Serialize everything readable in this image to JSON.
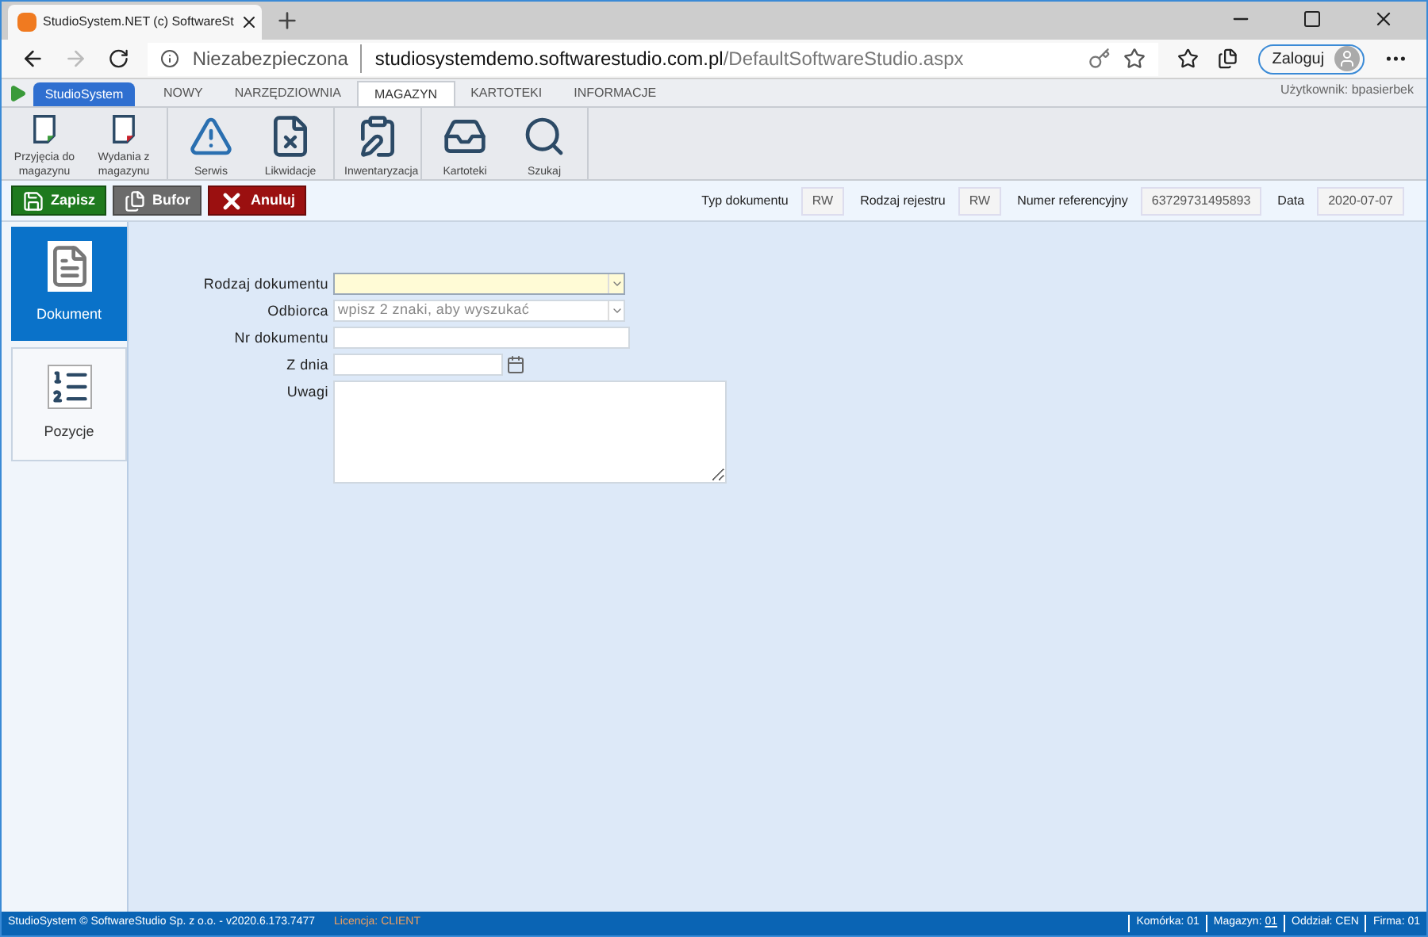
{
  "browser": {
    "tab_title": "StudioSystem.NET (c) SoftwareSt",
    "security": "Niezabezpieczona",
    "url_host": "studiosystemdemo.softwarestudio.com.pl",
    "url_path": "/DefaultSoftwareStudio.aspx",
    "profile_button": "Zaloguj"
  },
  "menu": {
    "app_button": "StudioSystem",
    "tabs": [
      {
        "label": "NOWY",
        "selected": false
      },
      {
        "label": "NARZĘDZIOWNIA",
        "selected": false
      },
      {
        "label": "MAGAZYN",
        "selected": true
      },
      {
        "label": "KARTOTEKI",
        "selected": false
      },
      {
        "label": "INFORMACJE",
        "selected": false
      }
    ],
    "user": "Użytkownik: bpasierbek"
  },
  "ribbon": [
    {
      "items": [
        {
          "kind": "doc-in",
          "label": "Przyjęcia do magazynu"
        },
        {
          "kind": "doc-out",
          "label": "Wydania z magazynu"
        }
      ]
    },
    {
      "items": [
        {
          "kind": "warning",
          "label": "Serwis"
        },
        {
          "kind": "doc-x",
          "label": "Likwidacje"
        }
      ]
    },
    {
      "items": [
        {
          "kind": "clipboard",
          "label": "Inwentaryzacja"
        }
      ]
    },
    {
      "items": [
        {
          "kind": "inbox",
          "label": "Kartoteki"
        },
        {
          "kind": "search",
          "label": "Szukaj"
        }
      ]
    }
  ],
  "actions": [
    {
      "kind": "save",
      "label": "Zapisz"
    },
    {
      "kind": "buffer",
      "label": "Bufor"
    },
    {
      "kind": "cancel",
      "label": "Anuluj"
    }
  ],
  "header_fields": [
    {
      "label": "Typ dokumentu",
      "value": "RW"
    },
    {
      "label": "Rodzaj rejestru",
      "value": "RW"
    },
    {
      "label": "Numer referencyjny",
      "value": "63729731495893"
    },
    {
      "label": "Data",
      "value": "2020-07-07"
    }
  ],
  "side_tabs": [
    {
      "kind": "document",
      "label": "Dokument",
      "selected": true
    },
    {
      "kind": "list",
      "label": "Pozycje",
      "selected": false
    }
  ],
  "form": [
    {
      "kind": "combo",
      "label": "Rodzaj dokumentu",
      "focused": true
    },
    {
      "kind": "combo",
      "label": "Odbiorca",
      "placeholder": "wpisz 2 znaki, aby wyszukać",
      "focused": false
    },
    {
      "kind": "text",
      "label": "Nr dokumentu"
    },
    {
      "kind": "date",
      "label": "Z dnia"
    },
    {
      "kind": "textarea",
      "label": "Uwagi"
    }
  ],
  "status_bar": {
    "copyright": "StudioSystem © SoftwareStudio Sp. z o.o. - v2020.6.173.7477",
    "license": "Licencja: CLIENT",
    "items": [
      {
        "label": "Komórka: 01"
      },
      {
        "label": "Magazyn:",
        "link": "01"
      },
      {
        "label": "Oddział: CEN"
      },
      {
        "label": "Firma: 01"
      }
    ]
  }
}
